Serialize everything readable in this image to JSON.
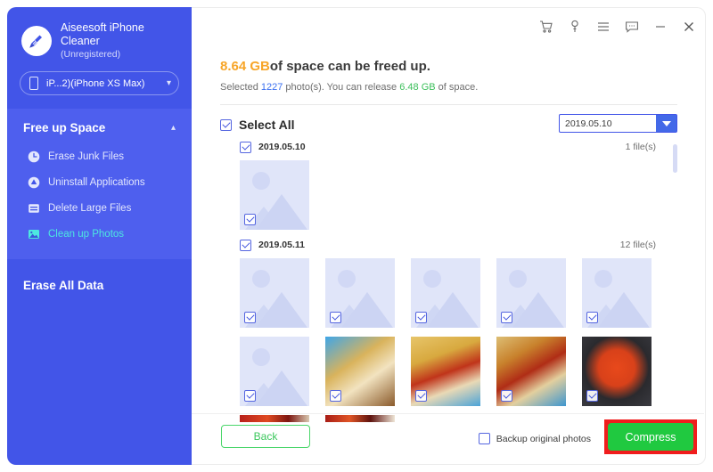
{
  "sidebar": {
    "logo_icon": "broom-logo-icon",
    "brand_line1": "Aiseesoft iPhone",
    "brand_line2": "Cleaner",
    "registration": "(Unregistered)",
    "device": {
      "icon": "phone-icon",
      "label": "iP...2)(iPhone XS Max)",
      "chevron": "chevron-down-icon"
    },
    "group": {
      "title": "Free up Space",
      "chevron": "chevron-up-icon",
      "items": [
        {
          "label": "Erase Junk Files",
          "icon": "clock-icon",
          "active": false
        },
        {
          "label": "Uninstall Applications",
          "icon": "app-remove-icon",
          "active": false
        },
        {
          "label": "Delete Large Files",
          "icon": "file-lines-icon",
          "active": false
        },
        {
          "label": "Clean up Photos",
          "icon": "photo-icon",
          "active": true
        }
      ]
    },
    "erase_all": "Erase All Data"
  },
  "titlebar": {
    "icons": [
      {
        "name": "cart-icon",
        "glyph": "⌸"
      },
      {
        "name": "key-icon",
        "glyph": "⚷"
      },
      {
        "name": "menu-icon",
        "glyph": "☰"
      },
      {
        "name": "feedback-icon",
        "glyph": "⌨"
      },
      {
        "name": "minimize-icon",
        "glyph": "−"
      },
      {
        "name": "close-icon",
        "glyph": "✕"
      }
    ]
  },
  "main": {
    "headline_size": "8.64 GB",
    "headline_rest": "of space can be freed up.",
    "subline_pre": "Selected ",
    "subline_count": "1227",
    "subline_mid": " photo(s). You can release ",
    "subline_release": "6.48 GB",
    "subline_post": " of space.",
    "select_all_label": "Select All",
    "select_all_checked": true,
    "date_filter_value": "2019.05.10",
    "groups": [
      {
        "date": "2019.05.10",
        "count": "1 file(s)",
        "checked": true
      },
      {
        "date": "2019.05.11",
        "count": "12 file(s)",
        "checked": true
      }
    ]
  },
  "footer": {
    "back_label": "Back",
    "backup_label": "Backup original photos",
    "backup_checked": false,
    "compress_label": "Compress",
    "highlight_color": "#f01d1d"
  },
  "colors": {
    "sidebar_bg": "#4255e8",
    "sidebar_panel": "#4e5fee",
    "accent_orange": "#f7a528",
    "accent_green": "#3bbf5a",
    "accent_blue": "#3a6ff0",
    "active_cyan": "#4de8e0",
    "compress_green": "#20c940"
  }
}
